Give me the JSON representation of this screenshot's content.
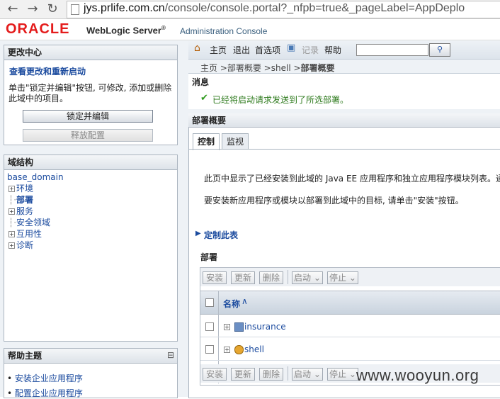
{
  "browser": {
    "url_host": "jys.prlife.com.cn",
    "url_path": "/console/console.portal?_nfpb=true&_pageLabel=AppDeplo"
  },
  "header": {
    "brand": "ORACLE",
    "product": "WebLogic Server",
    "product_mark": "®",
    "subtitle": "Administration Console"
  },
  "change_center": {
    "title": "更改中心",
    "link": "查看更改和重新启动",
    "description": "单击\"锁定并编辑\"按钮, 可修改, 添加或删除此域中的项目。",
    "lock_button": "锁定并编辑",
    "release_button": "释放配置"
  },
  "domain_structure": {
    "title": "域结构",
    "root": "base_domain",
    "items": [
      {
        "label": "环境",
        "expandable": true
      },
      {
        "label": "部署",
        "expandable": false,
        "selected": true
      },
      {
        "label": "服务",
        "expandable": true
      },
      {
        "label": "安全领域",
        "expandable": false
      },
      {
        "label": "互用性",
        "expandable": true
      },
      {
        "label": "诊断",
        "expandable": true
      }
    ]
  },
  "help": {
    "title": "帮助主题",
    "collapse": "⊟",
    "items": [
      "安装企业应用程序",
      "配置企业应用程序"
    ]
  },
  "toolbar": {
    "home": "主页",
    "logout": "退出",
    "preferences": "首选项",
    "record": "记录",
    "help": "帮助",
    "search_value": ""
  },
  "breadcrumb": {
    "parts": "主页 >部署概要 >shell >",
    "current": "部署概要"
  },
  "messages": {
    "title": "消息",
    "text": "已经将启动请求发送到了所选部署。"
  },
  "deployments": {
    "title": "部署概要",
    "tabs": [
      "控制",
      "监视"
    ],
    "intro1": "此页中显示了已经安装到此域的 Java EE 应用程序和独立应用程序模块列表。通",
    "intro2": "要安装新应用程序或模块以部署到此域中的目标, 请单击\"安装\"按钮。",
    "customize": "定制此表",
    "table_title": "部署",
    "buttons": {
      "install": "安装",
      "update": "更新",
      "delete": "删除",
      "start": "启动",
      "stop": "停止"
    },
    "column_name": "名称",
    "rows": [
      {
        "name": "insurance"
      },
      {
        "name": "shell"
      }
    ]
  },
  "watermark": "www.wooyun.org",
  "colors": {
    "oracle_red": "#e41c1c",
    "link_blue": "#1a4a9e",
    "success_green": "#2d7a1c"
  }
}
